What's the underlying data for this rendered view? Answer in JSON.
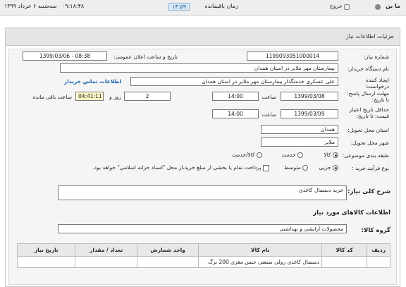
{
  "topbar": {
    "user": "ما بن",
    "exit": "خروج",
    "remaining_label": "زمان باقیمانده",
    "remaining_time": "۱۴:۵۹",
    "clock": "۰۹:۱۸:۴۸",
    "date": "سه‌شنبه ۶ خرداد ۱۳۹۹"
  },
  "panel": {
    "title": "جزئیات اطلاعات نیاز"
  },
  "form": {
    "need_number_label": "شماره نیاز:",
    "need_number": "1199093051000014",
    "announce_label": "تاریخ و ساعت اعلان عمومی:",
    "announce_value": "1399/03/06 - 08:38",
    "buyer_label": "نام دستگاه خریدار:",
    "buyer_value": "بیمارستان مهر ملایر در استان همدان",
    "creator_label": "ایجاد کننده درخواست:",
    "creator_value": "علی عسکری خدمتگذار بیمارستان مهر ملایر در استان همدان",
    "contact_link": "اطلاعات تماس خریدار",
    "reply_label": "مهلت ارسال پاسخ: تا تاریخ:",
    "reply_date": "1399/03/08",
    "time_label": "ساعت",
    "reply_time": "14:00",
    "days_value": "2",
    "days_label": "روز و",
    "remaining_value": "04:41:11",
    "remaining_label": "ساعت باقی مانده",
    "validity_label": "حداقل تاریخ اعتبار قیمت: تا تاریخ:",
    "validity_date": "1399/03/09",
    "validity_time": "14:00",
    "province_label": "استان محل تحویل:",
    "province_value": "همدان",
    "city_label": "شهر محل تحویل:",
    "city_value": "ملایر",
    "category_label": "طبقه بندی موضوعی:",
    "category_options": [
      "کالا",
      "خدمت",
      "کالا/خدمت"
    ],
    "process_label": "نوع فرآیند خرید :",
    "process_options": [
      "جزیی",
      "متوسط"
    ],
    "payment_note": "پرداخت تمام یا بخشی از مبلغ خرید،از محل \"اسناد خزانه اسلامی\" خواهد بود."
  },
  "summary": {
    "title": "شرح کلی نیاز:",
    "value": "خرید دستمال کاغذی"
  },
  "goods": {
    "title": "اطلاعات کالاهای مورد نیاز",
    "group_label": "گروه کالا:",
    "group_value": "محصولات آرایشی و بهداشتی",
    "columns": [
      "ردیف",
      "کد کالا",
      "نام کالا",
      "واحد شمارش",
      "تعداد / مقدار",
      "تاریخ نیاز"
    ],
    "rows": [
      [
        "",
        "",
        "دستمال کاغذی رولی صنعتی جنس مغزی 200 برگ",
        "",
        "",
        ""
      ]
    ]
  },
  "colors": {
    "link": "#1a5fb4",
    "timer_bg": "#fff8c8",
    "header_bg": "#e5e5e5"
  }
}
